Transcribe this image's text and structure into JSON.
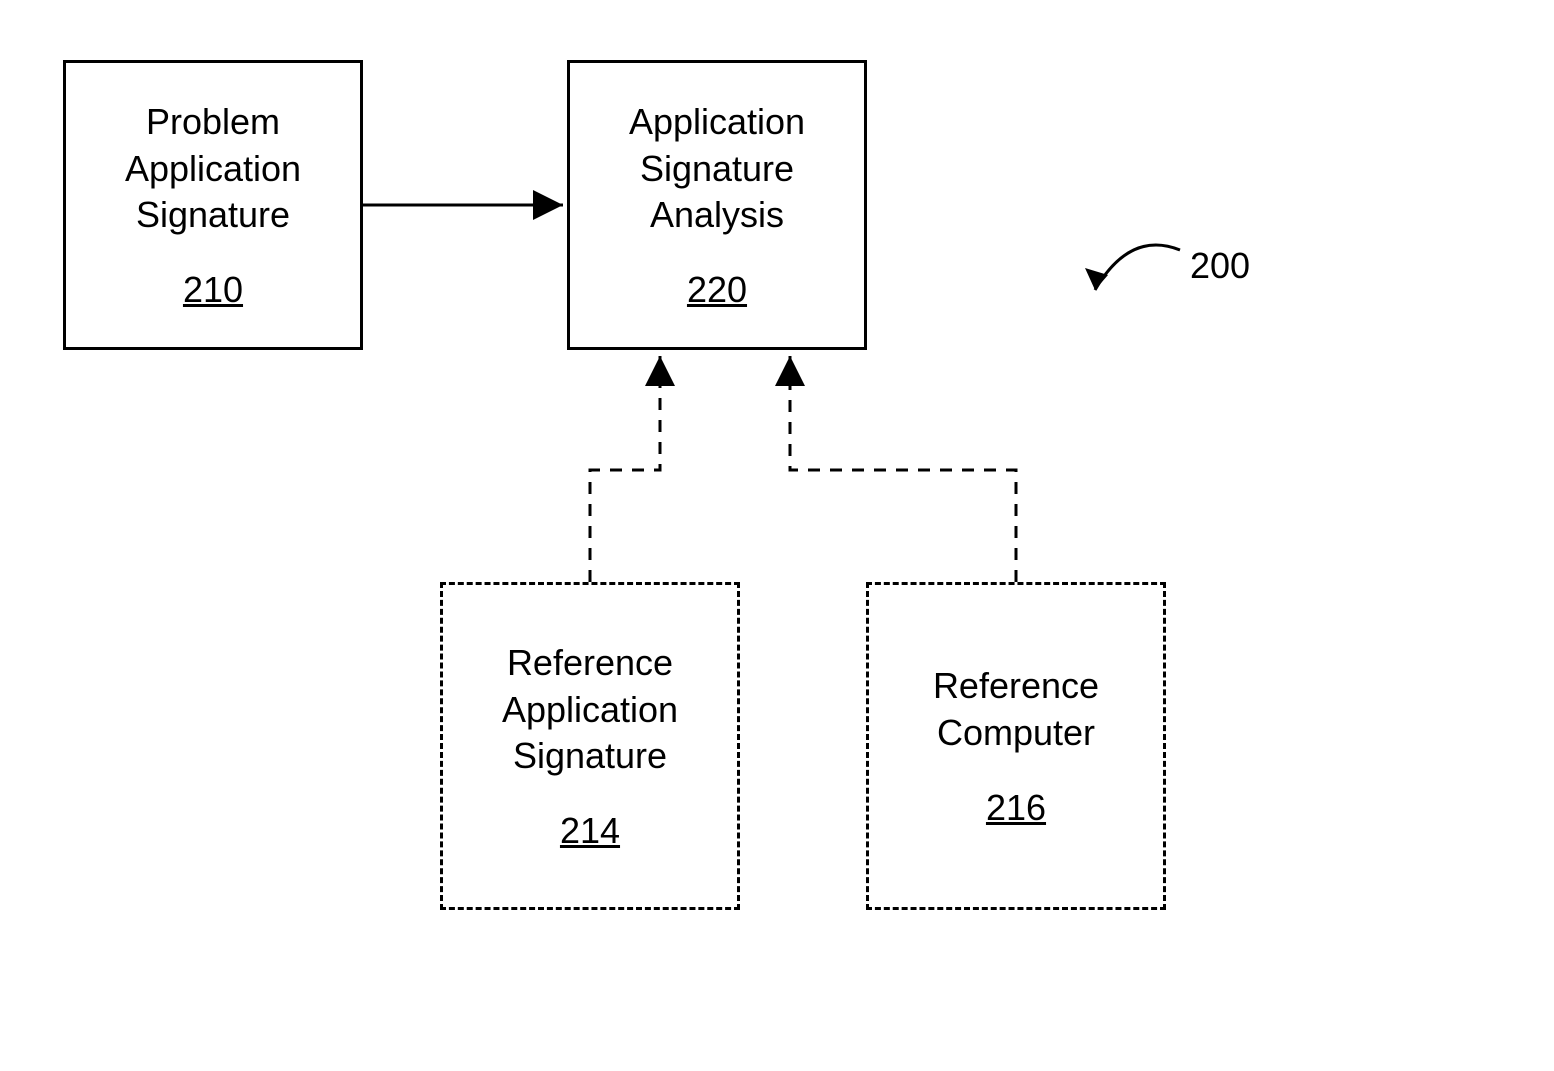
{
  "diagram_label": "200",
  "boxes": {
    "problem": {
      "title": "Problem Application Signature",
      "ref": "210"
    },
    "analysis": {
      "title": "Application Signature Analysis",
      "ref": "220"
    },
    "refApp": {
      "title": "Reference Application Signature",
      "ref": "214"
    },
    "refComp": {
      "title": "Reference Computer",
      "ref": "216"
    }
  }
}
